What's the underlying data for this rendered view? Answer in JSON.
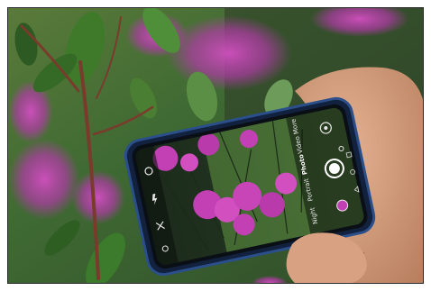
{
  "image": {
    "camera_modes": [
      "Night",
      "Portrait",
      "Photo",
      "Video",
      "More"
    ],
    "selected_mode": "Photo",
    "icons": [
      "settings-gear-icon",
      "flash-icon",
      "filter-icon",
      "lens-switch-icon",
      "gallery-thumbnail-icon",
      "shutter-button-icon",
      "camera-switch-icon"
    ],
    "colors": {
      "flower_magenta": "#c23fb4",
      "leaf_green": "#4f8f3a",
      "phone_body": "#12213d",
      "phone_rim": "#2b4f8a",
      "skin": "#d7a182"
    }
  }
}
